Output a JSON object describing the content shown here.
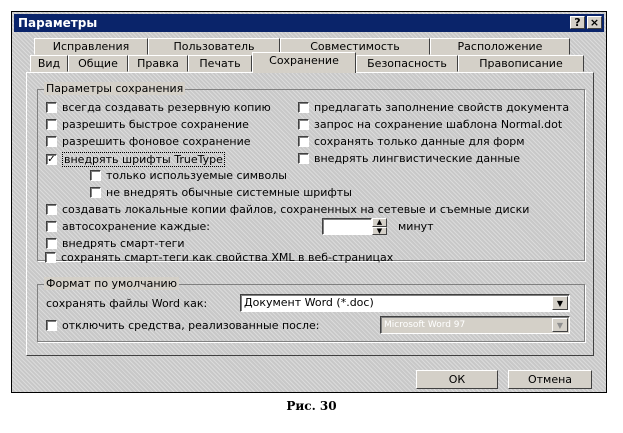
{
  "window": {
    "title": "Параметры",
    "help_btn": "?",
    "close_btn": "×"
  },
  "tabs_back": [
    "Исправления",
    "Пользователь",
    "Совместимость",
    "Расположение"
  ],
  "tabs_front": [
    "Вид",
    "Общие",
    "Правка",
    "Печать",
    "Сохранение",
    "Безопасность",
    "Правописание"
  ],
  "active_tab": "Сохранение",
  "save_group": {
    "title": "Параметры сохранения",
    "options": [
      {
        "label": "всегда создавать резервную копию",
        "checked": false
      },
      {
        "label": "предлагать заполнение свойств документа",
        "checked": false
      },
      {
        "label": "разрешить быстрое сохранение",
        "checked": false
      },
      {
        "label": "запрос на сохранение шаблона Normal.dot",
        "checked": false
      },
      {
        "label": "разрешить фоновое сохранение",
        "checked": false
      },
      {
        "label": "сохранять только данные для форм",
        "checked": false
      },
      {
        "label": "внедрять шрифты TrueType",
        "checked": true
      },
      {
        "label": "внедрять лингвистические данные",
        "checked": false
      },
      {
        "label": "только используемые символы",
        "checked": false
      },
      {
        "label": "не внедрять обычные системные шрифты",
        "checked": false
      },
      {
        "label": "создавать локальные копии файлов, сохраненных на сетевые и съемные диски",
        "checked": false
      },
      {
        "label": "автосохранение каждые:",
        "checked": false
      },
      {
        "label": "внедрять смарт-теги",
        "checked": false
      },
      {
        "label": "сохранять смарт-теги как свойства XML в веб-страницах",
        "checked": false
      }
    ],
    "autosave_value": "",
    "autosave_unit": "минут"
  },
  "format_group": {
    "title": "Формат по умолчанию",
    "save_as_label": "сохранять файлы Word как:",
    "save_as_value": "Документ Word (*.doc)",
    "disable_label": "отключить средства, реализованные после:",
    "disable_value": "Microsoft Word 97"
  },
  "buttons": {
    "ok": "ОК",
    "cancel": "Отмена"
  },
  "caption": "Рис. 30"
}
